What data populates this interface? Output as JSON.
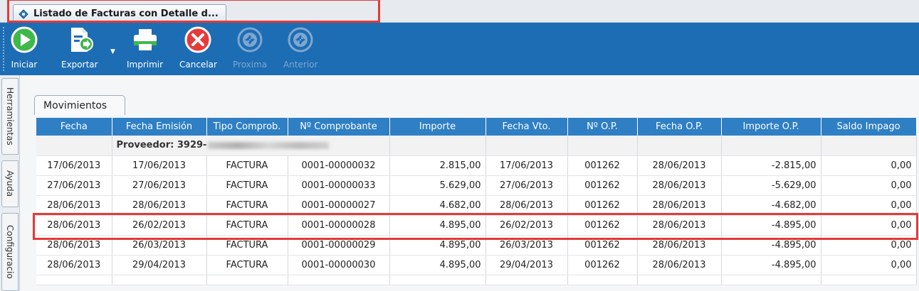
{
  "window": {
    "tab_title": "Listado de Facturas con Detalle d...",
    "highlight_color": "#e53a3a"
  },
  "toolbar": {
    "background": "#1d6db4",
    "buttons": [
      {
        "label": "Iniciar",
        "icon": "play-icon",
        "enabled": true
      },
      {
        "label": "Exportar",
        "icon": "export-document-icon",
        "enabled": true
      },
      {
        "label": "Imprimir",
        "icon": "printer-icon",
        "enabled": true
      },
      {
        "label": "Cancelar",
        "icon": "cancel-icon",
        "enabled": true
      },
      {
        "label": "Proxima",
        "icon": "next-icon",
        "enabled": false
      },
      {
        "label": "Anterior",
        "icon": "previous-icon",
        "enabled": false
      }
    ]
  },
  "sidebar": {
    "tabs": [
      "Herramientas",
      "Ayuda",
      "Configuracio"
    ]
  },
  "panel": {
    "tab_label": "Movimientos"
  },
  "table": {
    "columns": [
      "Fecha",
      "Fecha Emisión",
      "Tipo Comprob.",
      "Nº Comprobante",
      "Importe",
      "Fecha Vto.",
      "Nº O.P.",
      "Fecha O.P.",
      "Importe O.P.",
      "Saldo Impago"
    ],
    "group_label": "Proveedor: 3929-",
    "rows": [
      {
        "fecha": "17/06/2013",
        "emision": "17/06/2013",
        "tipo": "FACTURA",
        "numero": "0001-00000032",
        "importe": "2.815,00",
        "vto": "17/06/2013",
        "op": "001262",
        "fecha_op": "28/06/2013",
        "importe_op": "-2.815,00",
        "saldo": "0,00"
      },
      {
        "fecha": "27/06/2013",
        "emision": "27/06/2013",
        "tipo": "FACTURA",
        "numero": "0001-00000033",
        "importe": "5.629,00",
        "vto": "27/06/2013",
        "op": "001262",
        "fecha_op": "28/06/2013",
        "importe_op": "-5.629,00",
        "saldo": "0,00"
      },
      {
        "fecha": "28/06/2013",
        "emision": "28/06/2013",
        "tipo": "FACTURA",
        "numero": "0001-00000027",
        "importe": "4.682,00",
        "vto": "28/06/2013",
        "op": "001262",
        "fecha_op": "28/06/2013",
        "importe_op": "-4.682,00",
        "saldo": "0,00"
      },
      {
        "fecha": "28/06/2013",
        "emision": "26/02/2013",
        "tipo": "FACTURA",
        "numero": "0001-00000028",
        "importe": "4.895,00",
        "vto": "26/02/2013",
        "op": "001262",
        "fecha_op": "28/06/2013",
        "importe_op": "-4.895,00",
        "saldo": "0,00"
      },
      {
        "fecha": "28/06/2013",
        "emision": "26/03/2013",
        "tipo": "FACTURA",
        "numero": "0001-00000029",
        "importe": "4.895,00",
        "vto": "26/03/2013",
        "op": "001262",
        "fecha_op": "28/06/2013",
        "importe_op": "-4.895,00",
        "saldo": "0,00"
      },
      {
        "fecha": "28/06/2013",
        "emision": "29/04/2013",
        "tipo": "FACTURA",
        "numero": "0001-00000030",
        "importe": "4.895,00",
        "vto": "29/04/2013",
        "op": "001262",
        "fecha_op": "28/06/2013",
        "importe_op": "-4.895,00",
        "saldo": "0,00"
      }
    ]
  }
}
